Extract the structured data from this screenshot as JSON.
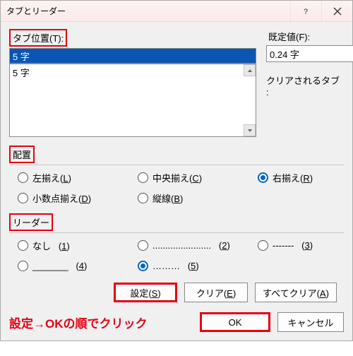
{
  "titlebar": {
    "title": "タブとリーダー"
  },
  "labels": {
    "tab_position": "タブ位置(T):",
    "default": "既定値(F):",
    "cleared": "クリアされるタブ :",
    "alignment": "配置",
    "leader": "リーダー"
  },
  "tab_input_value": "5 字",
  "list_items": [
    "5 字"
  ],
  "default_value": "0.24 字",
  "alignment": {
    "options": [
      {
        "key": "left",
        "label_pre": "左揃え(",
        "u": "L",
        "label_post": ")"
      },
      {
        "key": "center",
        "label_pre": "中央揃え(",
        "u": "C",
        "label_post": ")"
      },
      {
        "key": "right",
        "label_pre": "右揃え(",
        "u": "R",
        "label_post": ")"
      },
      {
        "key": "decimal",
        "label_pre": "小数点揃え(",
        "u": "D",
        "label_post": ")"
      },
      {
        "key": "bar",
        "label_pre": "縦線(",
        "u": "B",
        "label_post": ")"
      }
    ],
    "selected": "right"
  },
  "leader": {
    "options": [
      {
        "key": "1",
        "label": "なし",
        "num": "1"
      },
      {
        "key": "2",
        "label": ".......................",
        "num": "2"
      },
      {
        "key": "3",
        "label": "-------",
        "num": "3"
      },
      {
        "key": "4",
        "label": "_______",
        "num": "4"
      },
      {
        "key": "5",
        "label": "………",
        "num": "5"
      }
    ],
    "selected": "5"
  },
  "buttons": {
    "set": "設定(S)",
    "clear": "クリア(E)",
    "clear_all": "すべてクリア(A)",
    "ok": "OK",
    "cancel": "キャンセル"
  },
  "annotation": "設定→OKの順でクリック"
}
